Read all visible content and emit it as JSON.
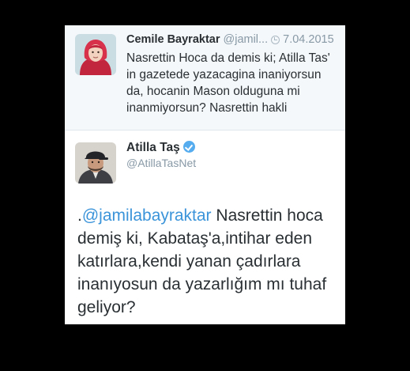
{
  "parent_tweet": {
    "name": "Cemile Bayraktar",
    "handle": "@jamil...",
    "date": "7.04.2015",
    "text": "Nasrettin Hoca da demis ki; Atilla Tas'\nin gazetede yazacagina inaniyorsun\nda, hocanin Mason olduguna mi\ninanmiyorsun? Nasrettin hakli",
    "avatar_icon": "user-avatar-hijab"
  },
  "reply_tweet": {
    "name": "Atilla Taş",
    "handle": "@AtillaTasNet",
    "verified_icon": "verified-badge-icon",
    "text_prefix": ".",
    "mention": "@jamilabayraktar",
    "text_body": " Nasrettin hoca demiş ki, Kabataş'a,intihar eden katırlara,kendi yanan çadırlara inanıyosun da yazarlığım mı tuhaf geliyor?",
    "avatar_icon": "user-avatar-cap"
  },
  "colors": {
    "background": "#000000",
    "card": "#ffffff",
    "parent_bg": "#f5f8fa",
    "link": "#3b94d9",
    "verified": "#55acee"
  }
}
